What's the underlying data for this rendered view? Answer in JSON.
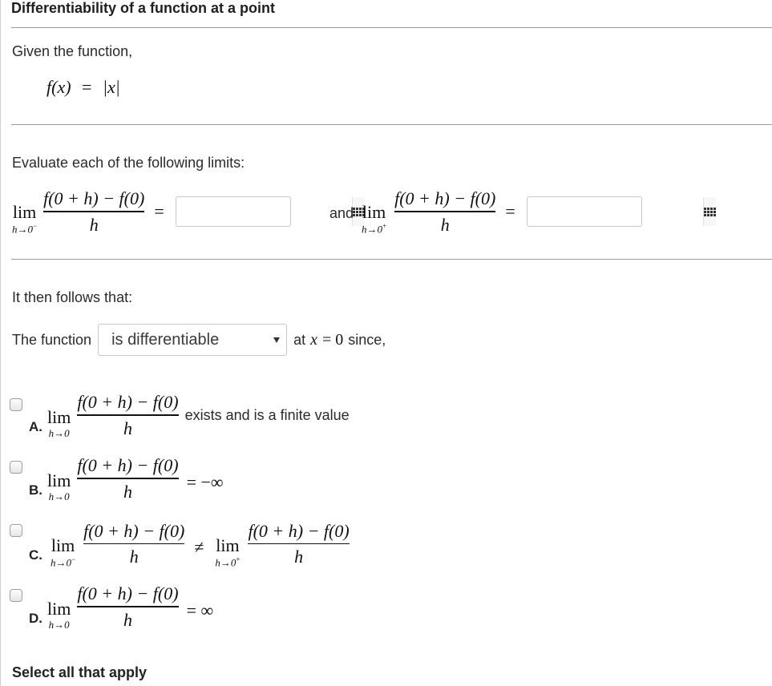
{
  "title": "Differentiability of a function at a point",
  "given": "Given the function,",
  "function_def": {
    "lhs": "f(x)",
    "eq": "=",
    "rhs": "|x|"
  },
  "evaluate": "Evaluate each of the following limits:",
  "limits": {
    "left": {
      "lim": "lim",
      "sub": "h→0",
      "sup": "−",
      "numerator": "f(0 + h) − f(0)",
      "denominator": "h",
      "eq": "=",
      "value": ""
    },
    "and": "and",
    "right": {
      "lim": "lim",
      "sub": "h→0",
      "sup": "+",
      "numerator": "f(0 + h) − f(0)",
      "denominator": "h",
      "eq": "=",
      "value": ""
    }
  },
  "follows": "It then follows that:",
  "statement": {
    "prefix": "The function",
    "selected": "is differentiable",
    "at": "at",
    "x": "x",
    "eq": "= 0",
    "since": "since,"
  },
  "options": [
    {
      "letter": "A.",
      "lim": "lim",
      "sub": "h→0",
      "numerator": "f(0 + h) − f(0)",
      "denominator": "h",
      "tail": "exists and is a finite value"
    },
    {
      "letter": "B.",
      "lim": "lim",
      "sub": "h→0",
      "numerator": "f(0 + h) − f(0)",
      "denominator": "h",
      "tail": "= −∞"
    },
    {
      "letter": "C.",
      "lim": "lim",
      "sub": "h→0",
      "sup": "−",
      "numerator": "f(0 + h) − f(0)",
      "denominator": "h",
      "neq": "≠",
      "lim2": "lim",
      "sub2": "h→0",
      "sup2": "+",
      "numerator2": "f(0 + h) − f(0)",
      "denominator2": "h"
    },
    {
      "letter": "D.",
      "lim": "lim",
      "sub": "h→0",
      "numerator": "f(0 + h) − f(0)",
      "denominator": "h",
      "tail": "= ∞"
    }
  ],
  "select_all": "Select all that apply"
}
